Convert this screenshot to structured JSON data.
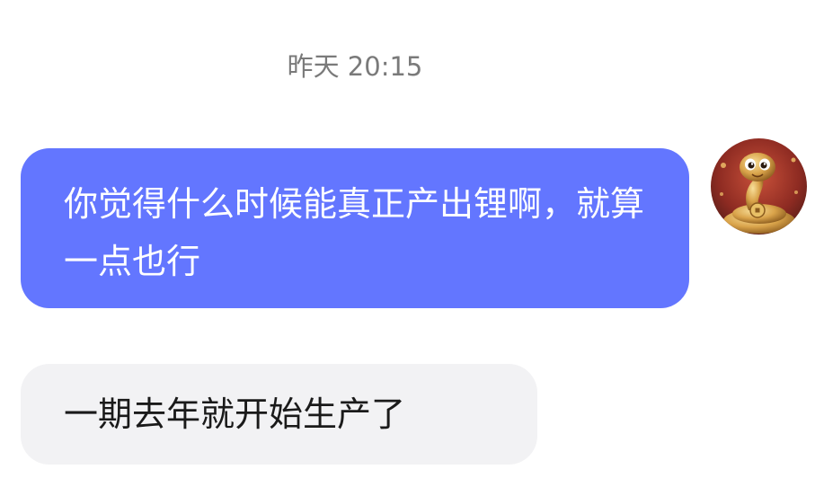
{
  "chat": {
    "timestamp": "昨天 20:15",
    "messages": [
      {
        "direction": "outgoing",
        "text": "你觉得什么时候能真正产出锂啊，就算一点也行",
        "bubble_color": "#6376ff",
        "avatar_icon": "golden-snake-avatar"
      },
      {
        "direction": "incoming",
        "text": "一期去年就开始生产了",
        "bubble_color": "#f2f2f4"
      }
    ]
  }
}
